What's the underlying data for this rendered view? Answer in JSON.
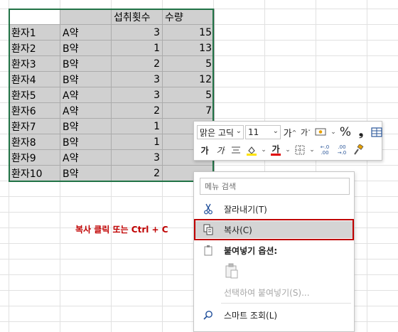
{
  "table": {
    "header": [
      "",
      "",
      "섭취횟수",
      "수량"
    ],
    "rows": [
      [
        "환자1",
        "A약",
        "3",
        "15"
      ],
      [
        "환자2",
        "B약",
        "1",
        "13"
      ],
      [
        "환자3",
        "B약",
        "2",
        "5"
      ],
      [
        "환자4",
        "B약",
        "3",
        "12"
      ],
      [
        "환자5",
        "A약",
        "3",
        "5"
      ],
      [
        "환자6",
        "A약",
        "2",
        "7"
      ],
      [
        "환자7",
        "B약",
        "1",
        ""
      ],
      [
        "환자8",
        "B약",
        "1",
        ""
      ],
      [
        "환자9",
        "A약",
        "3",
        ""
      ],
      [
        "환자10",
        "B약",
        "2",
        ""
      ]
    ]
  },
  "mini_toolbar": {
    "font_name": "맑은 고딕",
    "font_size": "11",
    "grow_font": "가",
    "shrink_font": "가",
    "percent": "%",
    "comma": "❟",
    "bold": "가",
    "italic": "가",
    "font_color_letter": "가",
    "decrease_decimal": "←.0 .00",
    "increase_decimal": ".00 →.0",
    "fill_color": "#ffe300",
    "font_color": "#e00000"
  },
  "context_menu": {
    "search_placeholder": "메뉴 검색",
    "items": {
      "cut": "잘라내기(T)",
      "copy": "복사(C)",
      "paste_options": "붙여넣기 옵션:",
      "paste_special": "선택하여 붙여넣기(S)...",
      "smart_lookup": "스마트 조회(L)"
    }
  },
  "annotation": "복사 클릭 또는 Ctrl + C",
  "colors": {
    "selection_border": "#217346",
    "selection_fill": "#d0d0d0",
    "highlight_border": "#c00000",
    "annotation_text": "#c00000"
  }
}
